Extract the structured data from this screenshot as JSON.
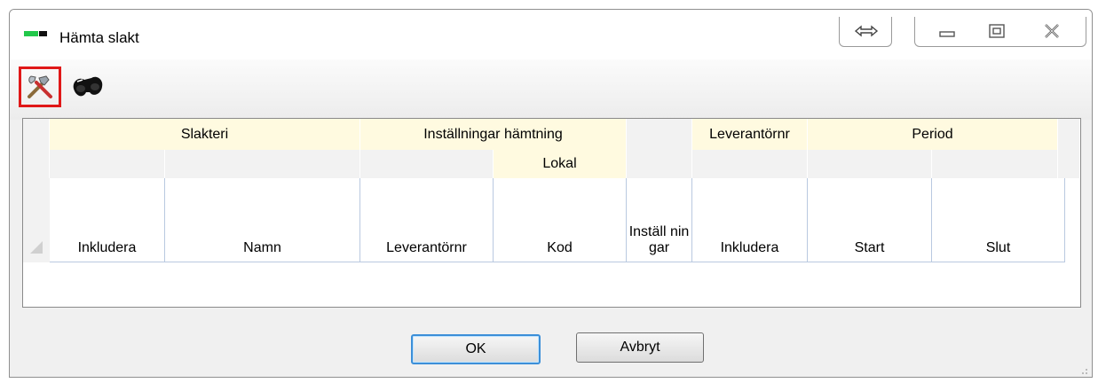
{
  "window": {
    "title": "Hämta slakt"
  },
  "toolbar": {
    "items": [
      {
        "icon": "tools-icon",
        "label": "Inställningar"
      },
      {
        "icon": "binoculars-icon",
        "label": "Sök"
      }
    ]
  },
  "grid": {
    "group_headers": [
      "Slakteri",
      "Inställningar hämtning",
      "",
      "Leverantörnr",
      "Period"
    ],
    "subgroup_headers": [
      "",
      "",
      "",
      "Lokal",
      "",
      "",
      "",
      ""
    ],
    "columns": [
      "Inkludera",
      "Namn",
      "Leverantörnr",
      "Kod",
      "Inställ ningar",
      "Inkludera",
      "Start",
      "Slut"
    ],
    "rows": []
  },
  "buttons": {
    "ok": "OK",
    "cancel": "Avbryt"
  },
  "colors": {
    "accent_yellow": "#fffae0",
    "focus_blue": "#3c8fd8",
    "highlight_red": "#e01818"
  }
}
